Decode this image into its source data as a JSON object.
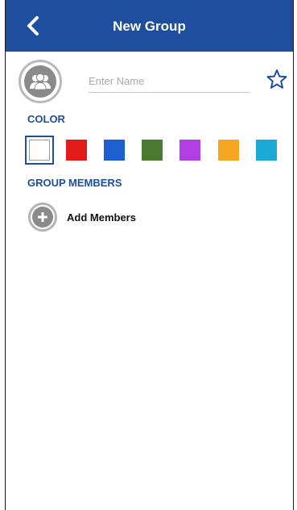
{
  "header": {
    "title": "New Group",
    "back_icon": "chevron-left-icon",
    "background_color": "#1f4e9e"
  },
  "group": {
    "avatar_icon": "group-avatar-icon",
    "name_value": "",
    "name_placeholder": "Enter Name",
    "favorite_icon": "star-outline-icon"
  },
  "color_section": {
    "label": "COLOR",
    "selected_index": 0,
    "swatches": [
      {
        "name": "white",
        "hex": "#ffffff"
      },
      {
        "name": "red",
        "hex": "#e31b1b"
      },
      {
        "name": "blue",
        "hex": "#1c5fd0"
      },
      {
        "name": "green",
        "hex": "#4a7a2f"
      },
      {
        "name": "purple",
        "hex": "#b33ee3"
      },
      {
        "name": "orange",
        "hex": "#f5a623"
      },
      {
        "name": "cyan",
        "hex": "#1aa8d4"
      }
    ]
  },
  "members_section": {
    "label": "GROUP MEMBERS",
    "add_label": "Add Members",
    "add_icon": "plus-circle-icon"
  }
}
